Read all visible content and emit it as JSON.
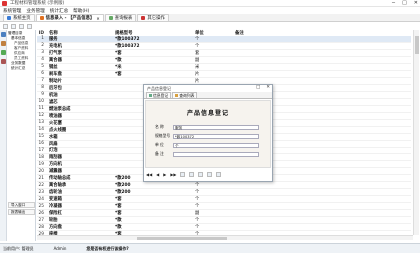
{
  "window": {
    "title": "工程材料管理系统 (示例版)",
    "controls": [
      "─",
      "□",
      "✕"
    ]
  },
  "menu": [
    "系统管理",
    "业务管理",
    "统计汇总",
    "帮助(H)"
  ],
  "tabs": [
    {
      "label": "系统主页",
      "active": false,
      "color": "#3a7bd5"
    },
    {
      "label": "信息录入 - 【产品信息】",
      "active": true,
      "color": "#e07020"
    },
    {
      "label": "查询报表",
      "active": false,
      "color": "#6a6"
    },
    {
      "label": "其它操作",
      "active": false,
      "color": "#c33"
    }
  ],
  "sidebar": {
    "tree": [
      {
        "level": 1,
        "label": "管理目录"
      },
      {
        "level": 2,
        "label": "基本信息"
      },
      {
        "level": 3,
        "label": "产品信息"
      },
      {
        "level": 3,
        "label": "客户资料"
      },
      {
        "level": 3,
        "label": "供应商"
      },
      {
        "level": 3,
        "label": "员工资料"
      },
      {
        "level": 2,
        "label": "业务数据"
      },
      {
        "level": 2,
        "label": "统计汇总"
      }
    ],
    "bottom": [
      "导入窗口",
      "报表输出"
    ]
  },
  "grid": {
    "columns": [
      "ID",
      "名称",
      "规格型号",
      "单位",
      "备注"
    ],
    "rows": [
      {
        "id": "1",
        "name": "服务",
        "spec": "*款100372",
        "unit": "个",
        "note": "",
        "selected": true
      },
      {
        "id": "2",
        "name": "充电机",
        "spec": "*款100372",
        "unit": "个",
        "note": ""
      },
      {
        "id": "3",
        "name": "打气泵",
        "spec": "*套",
        "unit": "套",
        "note": ""
      },
      {
        "id": "4",
        "name": "离合器",
        "spec": "*款",
        "unit": "副",
        "note": ""
      },
      {
        "id": "5",
        "name": "钢丝",
        "spec": "*米",
        "unit": "米",
        "note": ""
      },
      {
        "id": "6",
        "name": "刹车盘",
        "spec": "*套",
        "unit": "片",
        "note": ""
      },
      {
        "id": "7",
        "name": "制动片",
        "spec": "",
        "unit": "片",
        "note": ""
      },
      {
        "id": "8",
        "name": "后牙包",
        "spec": "",
        "unit": "",
        "note": ""
      },
      {
        "id": "9",
        "name": "机油",
        "spec": "",
        "unit": "",
        "note": ""
      },
      {
        "id": "10",
        "name": "滤芯",
        "spec": "",
        "unit": "",
        "note": ""
      },
      {
        "id": "11",
        "name": "燃油泵总成",
        "spec": "",
        "unit": "",
        "note": ""
      },
      {
        "id": "12",
        "name": "喷油器",
        "spec": "",
        "unit": "",
        "note": ""
      },
      {
        "id": "13",
        "name": "火花塞",
        "spec": "",
        "unit": "",
        "note": ""
      },
      {
        "id": "14",
        "name": "点火线圈",
        "spec": "",
        "unit": "",
        "note": ""
      },
      {
        "id": "15",
        "name": "水箱",
        "spec": "",
        "unit": "",
        "note": ""
      },
      {
        "id": "16",
        "name": "风扇",
        "spec": "",
        "unit": "",
        "note": ""
      },
      {
        "id": "17",
        "name": "灯泡",
        "spec": "",
        "unit": "",
        "note": ""
      },
      {
        "id": "18",
        "name": "雨刮器",
        "spec": "",
        "unit": "",
        "note": ""
      },
      {
        "id": "19",
        "name": "方向机",
        "spec": "",
        "unit": "",
        "note": ""
      },
      {
        "id": "20",
        "name": "减震器",
        "spec": "",
        "unit": "",
        "note": ""
      },
      {
        "id": "21",
        "name": "传动轴总成",
        "spec": "*款200",
        "unit": "个",
        "note": ""
      },
      {
        "id": "22",
        "name": "离合轴承",
        "spec": "*款200",
        "unit": "个",
        "note": ""
      },
      {
        "id": "23",
        "name": "齿轮油",
        "spec": "*款200",
        "unit": "个",
        "note": ""
      },
      {
        "id": "24",
        "name": "变速箱",
        "spec": "*套",
        "unit": "个",
        "note": ""
      },
      {
        "id": "25",
        "name": "冷凝器",
        "spec": "*套",
        "unit": "个",
        "note": ""
      },
      {
        "id": "26",
        "name": "保险杠",
        "spec": "*套",
        "unit": "副",
        "note": ""
      },
      {
        "id": "27",
        "name": "轮胎",
        "spec": "*款",
        "unit": "个",
        "note": ""
      },
      {
        "id": "28",
        "name": "方向盘",
        "spec": "*款",
        "unit": "个",
        "note": ""
      },
      {
        "id": "29",
        "name": "座椅",
        "spec": "*套",
        "unit": "个",
        "note": ""
      }
    ]
  },
  "dialog": {
    "title": "产品信息登记",
    "tabs": [
      "信息登记",
      "查询列表"
    ],
    "heading": "产品信息登记",
    "fields": [
      {
        "label": "名    称",
        "value": "服务"
      },
      {
        "label": "规格型号",
        "value": "*款100372"
      },
      {
        "label": "单    位",
        "value": "个"
      },
      {
        "label": "备    注",
        "value": ""
      }
    ],
    "nav": [
      "◀◀",
      "◀",
      "▶",
      "▶▶"
    ]
  },
  "status": {
    "user": "当前用户: 管理员",
    "role": "Admin",
    "hint": "您是否有权进行该操作?"
  }
}
